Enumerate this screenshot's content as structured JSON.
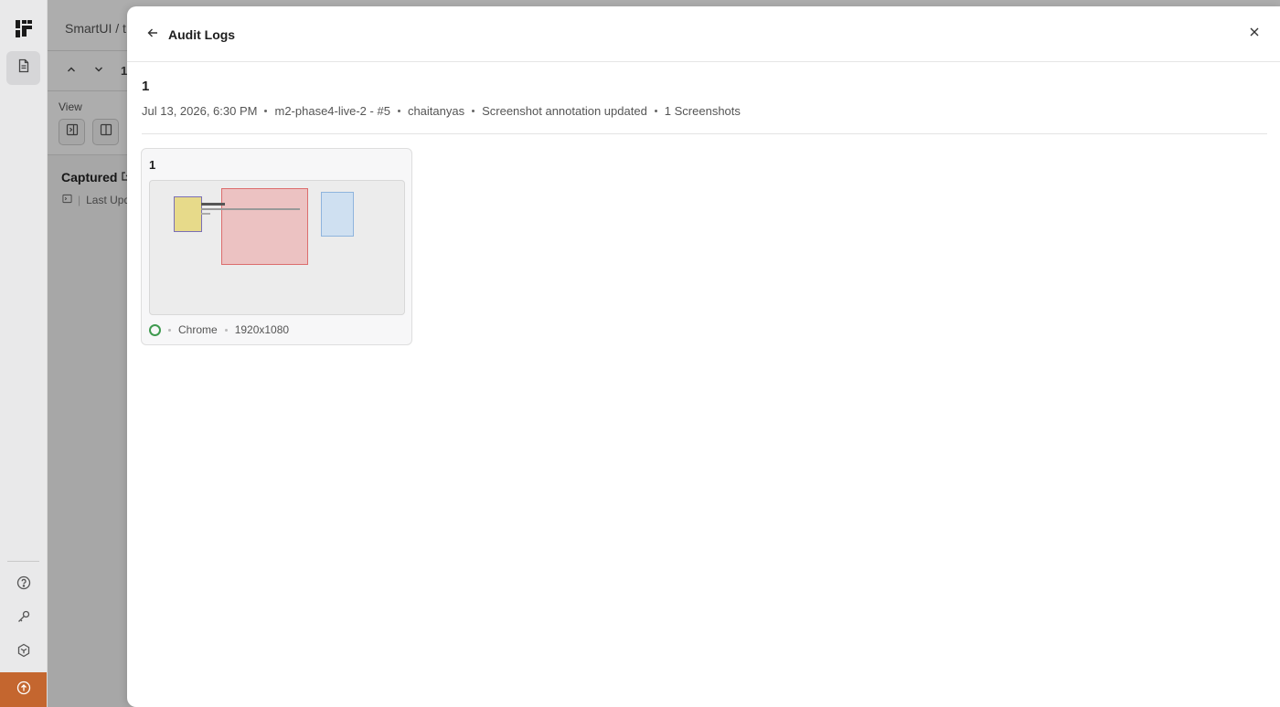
{
  "rail": {
    "logo_icon": "lambdatest-logo-icon",
    "items": [
      {
        "icon": "document-icon",
        "active": true
      },
      {
        "icon": "help-circle-icon"
      },
      {
        "icon": "key-icon"
      },
      {
        "icon": "integrations-icon"
      },
      {
        "icon": "upgrade-icon"
      }
    ],
    "accent_color": "#c4662f"
  },
  "background": {
    "breadcrumb": "SmartUI / t",
    "nav_number": "1",
    "view_label": "View",
    "captured_label": "Captured",
    "last_updated": "Last Upd"
  },
  "drawer": {
    "title": "Audit Logs",
    "back_icon": "arrow-left-icon",
    "close_icon": "close-icon"
  },
  "log": {
    "title": "1",
    "meta": [
      "Jul 13, 2026, 6:30 PM",
      "m2-phase4-live-2 - #5",
      "chaitanyas",
      "Screenshot annotation updated",
      "1 Screenshots"
    ]
  },
  "screenshot_card": {
    "title": "1",
    "browser": "Chrome",
    "resolution": "1920x1080",
    "status_color": "#3f9a4f"
  }
}
